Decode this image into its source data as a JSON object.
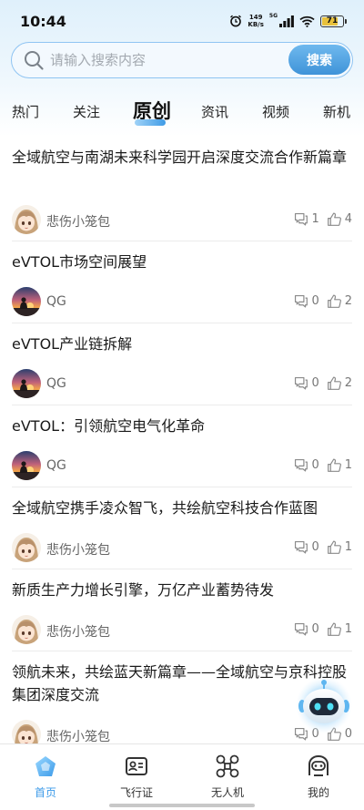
{
  "status_bar": {
    "time": "10:44",
    "net_speed_value": "149",
    "net_speed_unit": "KB/s",
    "signal_label": "5G",
    "battery": "71",
    "battery_level": 0.71,
    "icons": [
      "alarm-icon",
      "signal-icon",
      "wifi-icon",
      "battery-icon"
    ]
  },
  "search": {
    "placeholder": "请输入搜索内容",
    "button_label": "搜索",
    "icon": "search-icon"
  },
  "tabs": [
    {
      "label": "热门",
      "active": false
    },
    {
      "label": "关注",
      "active": false
    },
    {
      "label": "原创",
      "active": true
    },
    {
      "label": "资讯",
      "active": false
    },
    {
      "label": "视频",
      "active": false
    },
    {
      "label": "新机",
      "active": false
    }
  ],
  "articles": [
    {
      "title": "全域航空与南湖未来科学园开启深度交流合作新篇章",
      "author": "悲伤小笼包",
      "avatar": "anime-girl",
      "comments": "1",
      "likes": "4"
    },
    {
      "title": "eVTOL市场空间展望",
      "author": "QG",
      "avatar": "sunset-silhouette",
      "comments": "0",
      "likes": "2"
    },
    {
      "title": "eVTOL产业链拆解",
      "author": "QG",
      "avatar": "sunset-silhouette",
      "comments": "0",
      "likes": "2"
    },
    {
      "title": "eVTOL：引领航空电气化革命",
      "author": "QG",
      "avatar": "sunset-silhouette",
      "comments": "0",
      "likes": "1"
    },
    {
      "title": "全域航空携手凌众智飞，共绘航空科技合作蓝图",
      "author": "悲伤小笼包",
      "avatar": "anime-girl",
      "comments": "0",
      "likes": "1"
    },
    {
      "title": "新质生产力增长引擎，万亿产业蓄势待发",
      "author": "悲伤小笼包",
      "avatar": "anime-girl",
      "comments": "0",
      "likes": "1"
    },
    {
      "title": "领航未来，共绘蓝天新篇章——全域航空与京科控股集团深度交流",
      "author": "悲伤小笼包",
      "avatar": "anime-girl",
      "comments": "0",
      "likes": "0"
    }
  ],
  "bottom_nav": [
    {
      "label": "首页",
      "icon": "home-icon",
      "active": true
    },
    {
      "label": "飞行证",
      "icon": "license-card-icon",
      "active": false
    },
    {
      "label": "无人机",
      "icon": "drone-icon",
      "active": false
    },
    {
      "label": "我的",
      "icon": "profile-icon",
      "active": false
    }
  ],
  "colors": {
    "accent": "#3d9be9",
    "search_border": "#8fc4f2",
    "battery_fill": "#e8c13b"
  }
}
